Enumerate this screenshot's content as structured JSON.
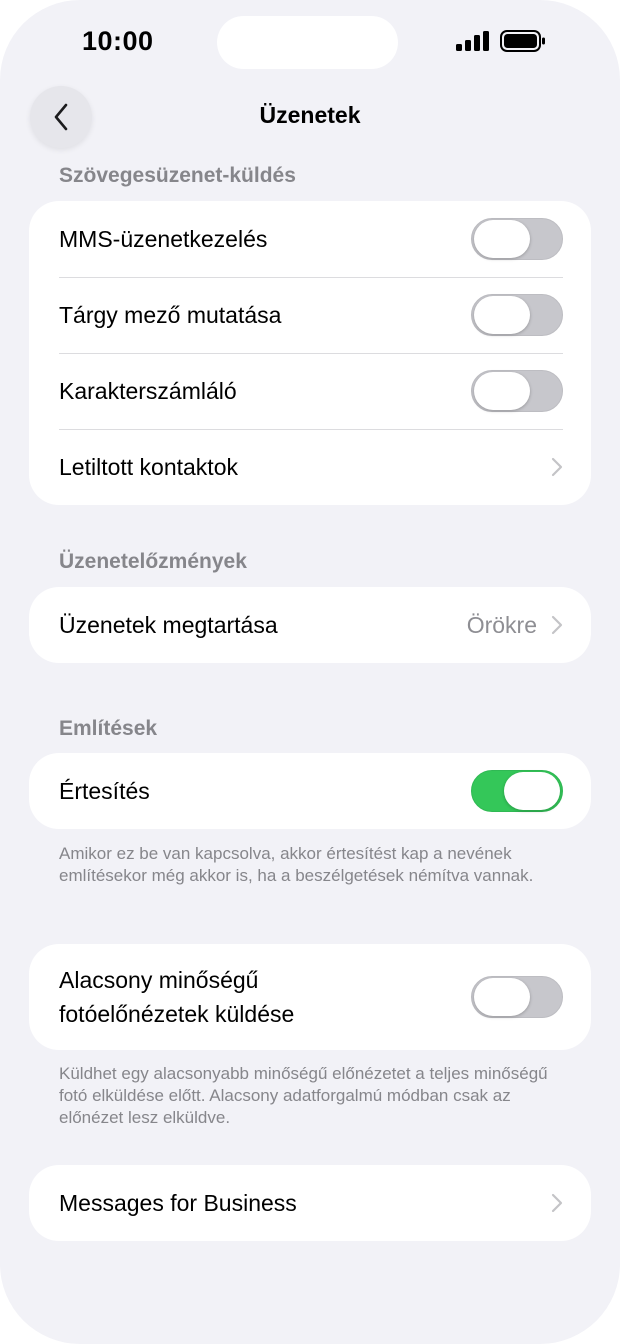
{
  "status_bar": {
    "time": "10:00"
  },
  "nav": {
    "title": "Üzenetek"
  },
  "sections": {
    "sms": {
      "header": "Szövegesüzenet-küldés",
      "mms_label": "MMS-üzenetkezelés",
      "subject_label": "Tárgy mező mutatása",
      "char_count_label": "Karakterszámláló",
      "blocked_label": "Letiltott kontaktok"
    },
    "history": {
      "header": "Üzenetelőzmények",
      "keep_label": "Üzenetek megtartása",
      "keep_value": "Örökre"
    },
    "mentions": {
      "header": "Említések",
      "notify_label": "Értesítés",
      "notify_note": "Amikor ez be van kapcsolva, akkor értesítést kap a nevének említésekor még akkor is, ha a beszélgetések némítva vannak."
    },
    "low_quality": {
      "label_line1": "Alacsony minőségű",
      "label_line2": "fotóelőnézetek küldése",
      "note": "Küldhet egy alacsonyabb minőségű előnézetet a teljes minőségű fotó elküldése előtt. Alacsony adatforgalmú módban csak az előnézet lesz elküldve."
    },
    "business": {
      "label": "Messages for Business"
    }
  },
  "toggles": {
    "mms": false,
    "subject": false,
    "char_count": false,
    "notify": true,
    "low_quality": false
  },
  "colors": {
    "toggle_on": "#34c759",
    "toggle_off": "#c7c7cc",
    "background": "#f2f2f7"
  }
}
